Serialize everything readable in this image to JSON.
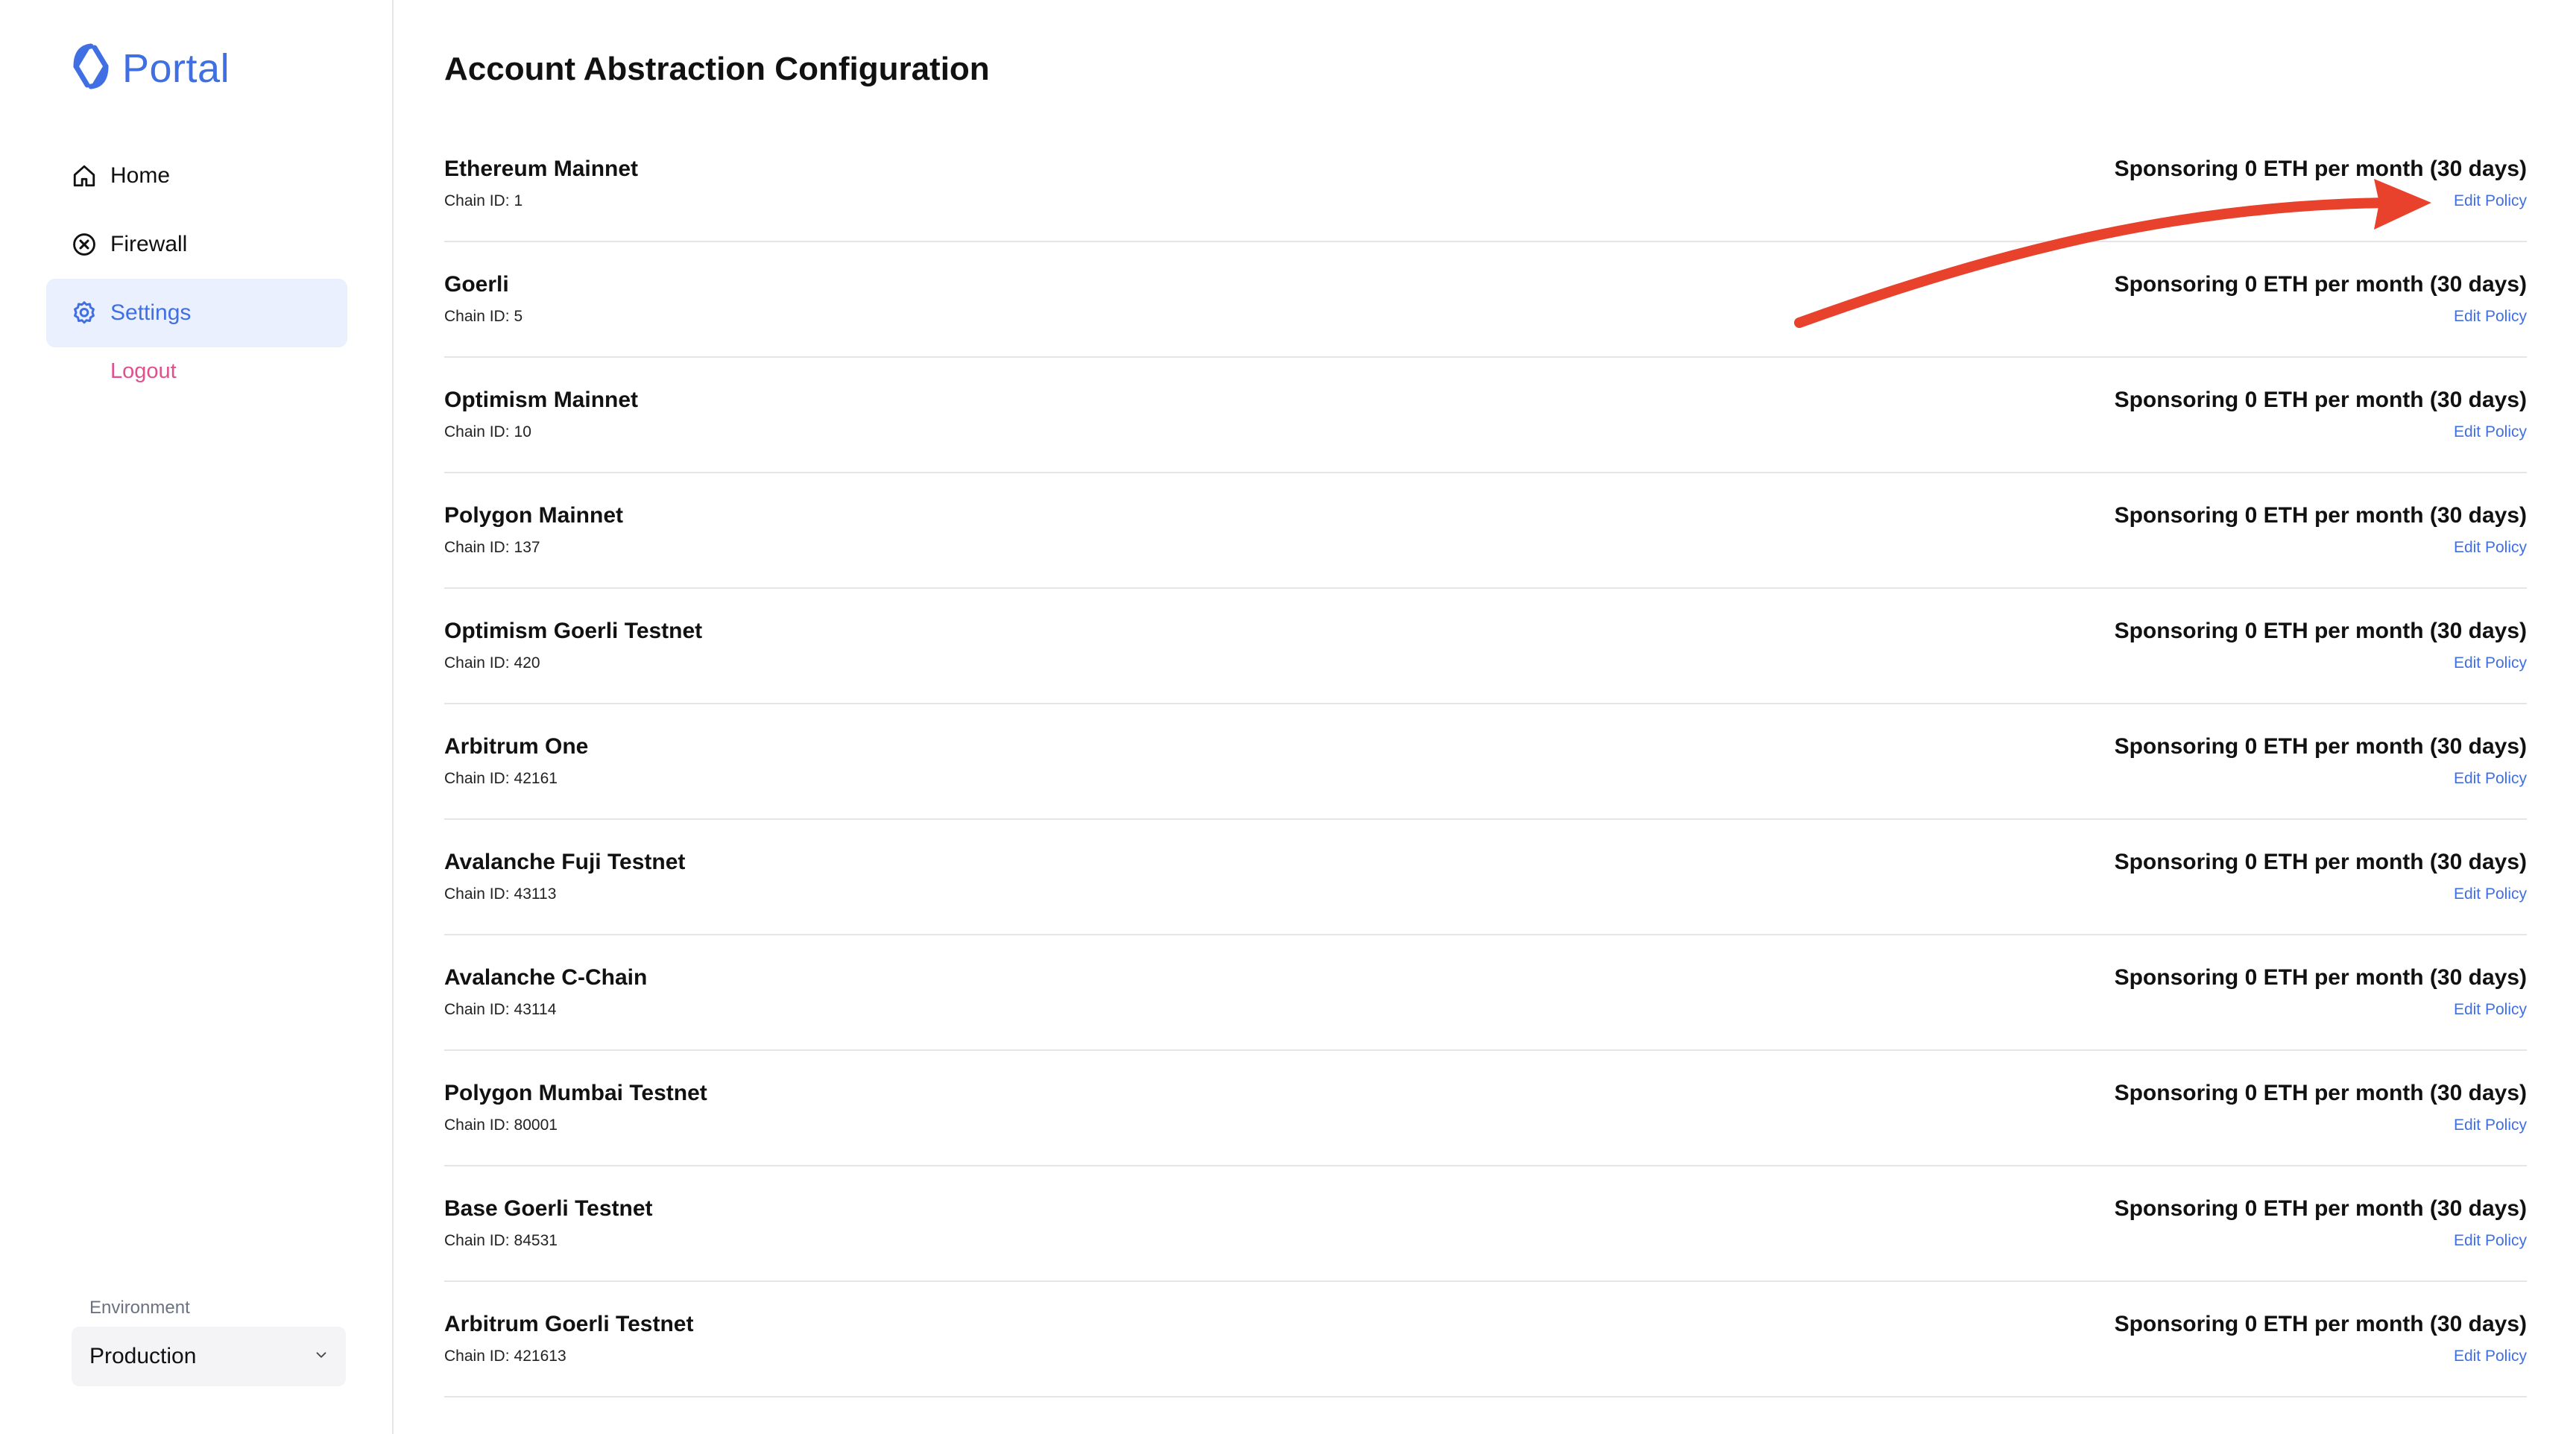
{
  "brand": {
    "name": "Portal",
    "accent": "#3f6fe3"
  },
  "sidebar": {
    "items": [
      {
        "label": "Home",
        "icon": "home-icon",
        "active": false
      },
      {
        "label": "Firewall",
        "icon": "x-circle-icon",
        "active": false
      },
      {
        "label": "Settings",
        "icon": "gear-icon",
        "active": true
      }
    ],
    "logout_label": "Logout",
    "environment": {
      "label": "Environment",
      "selected": "Production"
    }
  },
  "main": {
    "title": "Account Abstraction Configuration",
    "chain_id_label": "Chain ID:",
    "edit_label": "Edit Policy",
    "chains": [
      {
        "name": "Ethereum Mainnet",
        "chain_id": "1",
        "sponsoring": "Sponsoring 0 ETH per month (30 days)"
      },
      {
        "name": "Goerli",
        "chain_id": "5",
        "sponsoring": "Sponsoring 0 ETH per month (30 days)"
      },
      {
        "name": "Optimism Mainnet",
        "chain_id": "10",
        "sponsoring": "Sponsoring 0 ETH per month (30 days)"
      },
      {
        "name": "Polygon Mainnet",
        "chain_id": "137",
        "sponsoring": "Sponsoring 0 ETH per month (30 days)"
      },
      {
        "name": "Optimism Goerli Testnet",
        "chain_id": "420",
        "sponsoring": "Sponsoring 0 ETH per month (30 days)"
      },
      {
        "name": "Arbitrum One",
        "chain_id": "42161",
        "sponsoring": "Sponsoring 0 ETH per month (30 days)"
      },
      {
        "name": "Avalanche Fuji Testnet",
        "chain_id": "43113",
        "sponsoring": "Sponsoring 0 ETH per month (30 days)"
      },
      {
        "name": "Avalanche C-Chain",
        "chain_id": "43114",
        "sponsoring": "Sponsoring 0 ETH per month (30 days)"
      },
      {
        "name": "Polygon Mumbai Testnet",
        "chain_id": "80001",
        "sponsoring": "Sponsoring 0 ETH per month (30 days)"
      },
      {
        "name": "Base Goerli Testnet",
        "chain_id": "84531",
        "sponsoring": "Sponsoring 0 ETH per month (30 days)"
      },
      {
        "name": "Arbitrum Goerli Testnet",
        "chain_id": "421613",
        "sponsoring": "Sponsoring 0 ETH per month (30 days)"
      }
    ]
  },
  "annotation": {
    "type": "red-arrow-pointing-to-edit-policy",
    "color": "#e8412c"
  }
}
